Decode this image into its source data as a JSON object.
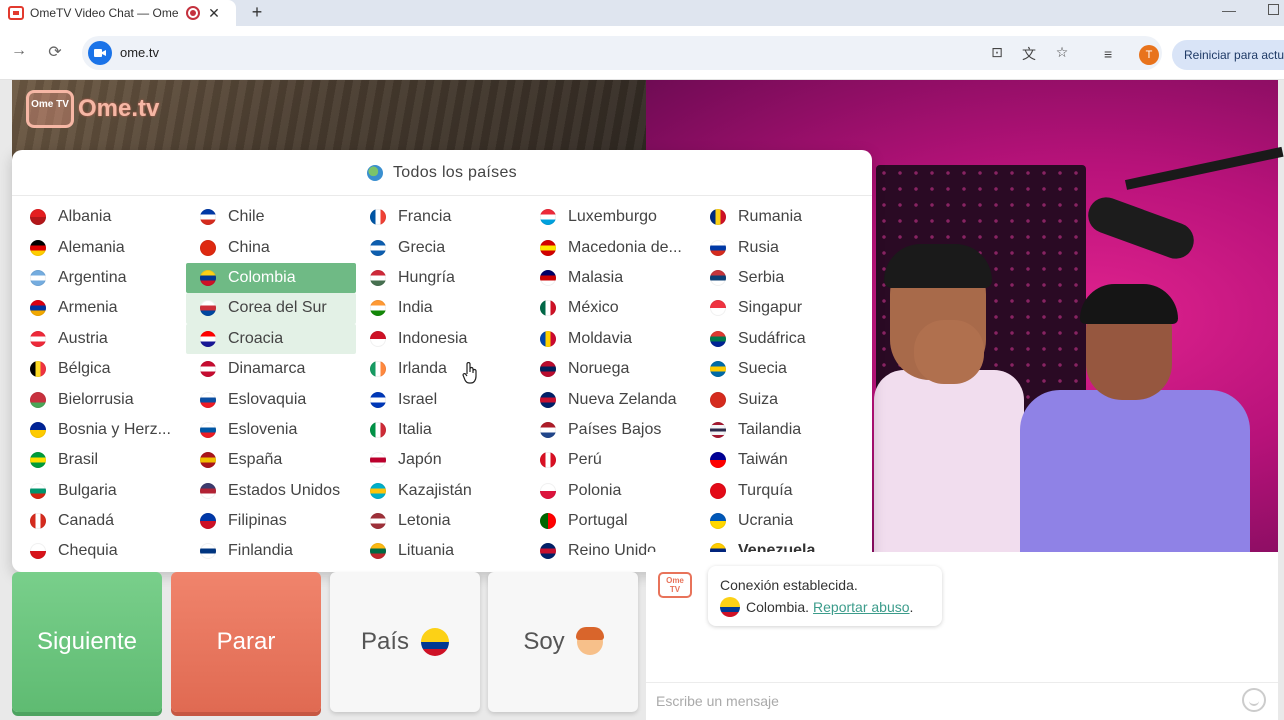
{
  "browser": {
    "tab_title": "OmeTV Video Chat — Ome",
    "tab_close": "✕",
    "new_tab": "+",
    "url": "ome.tv",
    "restart_label": "Reiniciar para actu",
    "profile_initial": "T"
  },
  "page": {
    "logo_small": "Ome TV",
    "logo_text": "Ome.tv",
    "all_countries_label": "Todos los países",
    "selected_country": "Colombia",
    "columns": [
      [
        {
          "name": "Albania",
          "flag": [
            "#e41e20",
            "#b3171a"
          ]
        },
        {
          "name": "Alemania",
          "flag": [
            "#000000",
            "#dd0000",
            "#ffce00"
          ]
        },
        {
          "name": "Argentina",
          "flag": [
            "#74acdf",
            "#ffffff",
            "#74acdf"
          ]
        },
        {
          "name": "Armenia",
          "flag": [
            "#d90012",
            "#0033a0",
            "#f2a800"
          ]
        },
        {
          "name": "Austria",
          "flag": [
            "#ed2939",
            "#ffffff",
            "#ed2939"
          ]
        },
        {
          "name": "Bélgica",
          "flag": [
            "#000000",
            "#fdda24",
            "#ef3340"
          ],
          "vertical": true
        },
        {
          "name": "Bielorrusia",
          "flag": [
            "#c8313e",
            "#c8313e",
            "#4aa657"
          ]
        },
        {
          "name": "Bosnia y Herz...",
          "flag": [
            "#002395",
            "#fecb00"
          ]
        },
        {
          "name": "Brasil",
          "flag": [
            "#009c3b",
            "#ffdf00",
            "#009c3b"
          ]
        },
        {
          "name": "Bulgaria",
          "flag": [
            "#ffffff",
            "#00966e",
            "#d62612"
          ]
        },
        {
          "name": "Canadá",
          "flag": [
            "#d52b1e",
            "#ffffff",
            "#d52b1e"
          ],
          "vertical": true
        },
        {
          "name": "Chequia",
          "flag": [
            "#ffffff",
            "#d7141a"
          ]
        }
      ],
      [
        {
          "name": "Chile",
          "flag": [
            "#0039a6",
            "#ffffff",
            "#d52b1e"
          ]
        },
        {
          "name": "China",
          "flag": [
            "#de2910",
            "#de2910"
          ]
        },
        {
          "name": "Colombia",
          "flag": [
            "#fcd116",
            "#003893",
            "#ce1126"
          ]
        },
        {
          "name": "Corea del Sur",
          "flag": [
            "#ffffff",
            "#cd2e3a",
            "#0047a0"
          ]
        },
        {
          "name": "Croacia",
          "flag": [
            "#ff0000",
            "#ffffff",
            "#171796"
          ]
        },
        {
          "name": "Dinamarca",
          "flag": [
            "#c60c30",
            "#ffffff",
            "#c60c30"
          ]
        },
        {
          "name": "Eslovaquia",
          "flag": [
            "#ffffff",
            "#0b4ea2",
            "#ee1c25"
          ]
        },
        {
          "name": "Eslovenia",
          "flag": [
            "#ffffff",
            "#0056a4",
            "#ed1c24"
          ]
        },
        {
          "name": "España",
          "flag": [
            "#aa151b",
            "#f1bf00",
            "#aa151b"
          ]
        },
        {
          "name": "Estados Unidos",
          "flag": [
            "#3c3b6e",
            "#b22234",
            "#ffffff"
          ]
        },
        {
          "name": "Filipinas",
          "flag": [
            "#0038a8",
            "#ce1126"
          ]
        },
        {
          "name": "Finlandia",
          "flag": [
            "#ffffff",
            "#003580",
            "#ffffff"
          ]
        }
      ],
      [
        {
          "name": "Francia",
          "flag": [
            "#0055a4",
            "#ffffff",
            "#ef4135"
          ],
          "vertical": true
        },
        {
          "name": "Grecia",
          "flag": [
            "#0d5eaf",
            "#ffffff",
            "#0d5eaf"
          ]
        },
        {
          "name": "Hungría",
          "flag": [
            "#ce2939",
            "#ffffff",
            "#477050"
          ]
        },
        {
          "name": "India",
          "flag": [
            "#ff9933",
            "#ffffff",
            "#138808"
          ]
        },
        {
          "name": "Indonesia",
          "flag": [
            "#ce1126",
            "#ffffff"
          ]
        },
        {
          "name": "Irlanda",
          "flag": [
            "#169b62",
            "#ffffff",
            "#ff883e"
          ],
          "vertical": true
        },
        {
          "name": "Israel",
          "flag": [
            "#0038b8",
            "#ffffff",
            "#0038b8"
          ]
        },
        {
          "name": "Italia",
          "flag": [
            "#009246",
            "#ffffff",
            "#ce2b37"
          ],
          "vertical": true
        },
        {
          "name": "Japón",
          "flag": [
            "#ffffff",
            "#bc002d",
            "#ffffff"
          ]
        },
        {
          "name": "Kazajistán",
          "flag": [
            "#00afca",
            "#fec50c",
            "#00afca"
          ]
        },
        {
          "name": "Letonia",
          "flag": [
            "#9e3039",
            "#ffffff",
            "#9e3039"
          ]
        },
        {
          "name": "Lituania",
          "flag": [
            "#fdb913",
            "#006a44",
            "#c1272d"
          ]
        }
      ],
      [
        {
          "name": "Luxemburgo",
          "flag": [
            "#ed2939",
            "#ffffff",
            "#00a1de"
          ]
        },
        {
          "name": "Macedonia de...",
          "flag": [
            "#d20000",
            "#ffe600",
            "#d20000"
          ]
        },
        {
          "name": "Malasia",
          "flag": [
            "#010066",
            "#cc0001",
            "#ffffff"
          ]
        },
        {
          "name": "México",
          "flag": [
            "#006847",
            "#ffffff",
            "#ce1126"
          ],
          "vertical": true
        },
        {
          "name": "Moldavia",
          "flag": [
            "#0046ae",
            "#ffd200",
            "#cc092f"
          ],
          "vertical": true
        },
        {
          "name": "Noruega",
          "flag": [
            "#ba0c2f",
            "#00205b",
            "#ba0c2f"
          ]
        },
        {
          "name": "Nueva Zelanda",
          "flag": [
            "#012169",
            "#c8102e",
            "#012169"
          ]
        },
        {
          "name": "Países Bajos",
          "flag": [
            "#ae1c28",
            "#ffffff",
            "#21468b"
          ]
        },
        {
          "name": "Perú",
          "flag": [
            "#d91023",
            "#ffffff",
            "#d91023"
          ],
          "vertical": true
        },
        {
          "name": "Polonia",
          "flag": [
            "#ffffff",
            "#dc143c"
          ]
        },
        {
          "name": "Portugal",
          "flag": [
            "#006600",
            "#ff0000"
          ],
          "vertical": true
        },
        {
          "name": "Reino Unido",
          "flag": [
            "#012169",
            "#c8102e",
            "#012169"
          ]
        }
      ],
      [
        {
          "name": "Rumania",
          "flag": [
            "#002b7f",
            "#fcd116",
            "#ce1126"
          ],
          "vertical": true
        },
        {
          "name": "Rusia",
          "flag": [
            "#ffffff",
            "#0039a6",
            "#d52b1e"
          ]
        },
        {
          "name": "Serbia",
          "flag": [
            "#c6363c",
            "#0c4076",
            "#ffffff"
          ]
        },
        {
          "name": "Singapur",
          "flag": [
            "#ef3340",
            "#ffffff"
          ]
        },
        {
          "name": "Sudáfrica",
          "flag": [
            "#de3831",
            "#007a4d",
            "#002395"
          ]
        },
        {
          "name": "Suecia",
          "flag": [
            "#006aa7",
            "#fecc00",
            "#006aa7"
          ]
        },
        {
          "name": "Suiza",
          "flag": [
            "#d52b1e",
            "#d52b1e"
          ]
        },
        {
          "name": "Tailandia",
          "flag": [
            "#a51931",
            "#f4f5f8",
            "#2d2a4a",
            "#f4f5f8",
            "#a51931"
          ]
        },
        {
          "name": "Taiwán",
          "flag": [
            "#000095",
            "#fe0000"
          ]
        },
        {
          "name": "Turquía",
          "flag": [
            "#e30a17",
            "#e30a17"
          ]
        },
        {
          "name": "Ucrania",
          "flag": [
            "#0057b7",
            "#ffd700"
          ]
        },
        {
          "name": "Venezuela",
          "flag": [
            "#ffcc00",
            "#00247d",
            "#cf142b"
          ],
          "bold": true
        }
      ]
    ],
    "buttons": {
      "next": "Siguiente",
      "stop": "Parar",
      "country": "País",
      "soy": "Soy"
    },
    "chat": {
      "logo": "Ome TV",
      "status": "Conexión establecida.",
      "partner_country": "Colombia.",
      "report_link": "Reportar abuso",
      "report_suffix": ".",
      "input_placeholder": "Escribe un mensaje"
    }
  }
}
